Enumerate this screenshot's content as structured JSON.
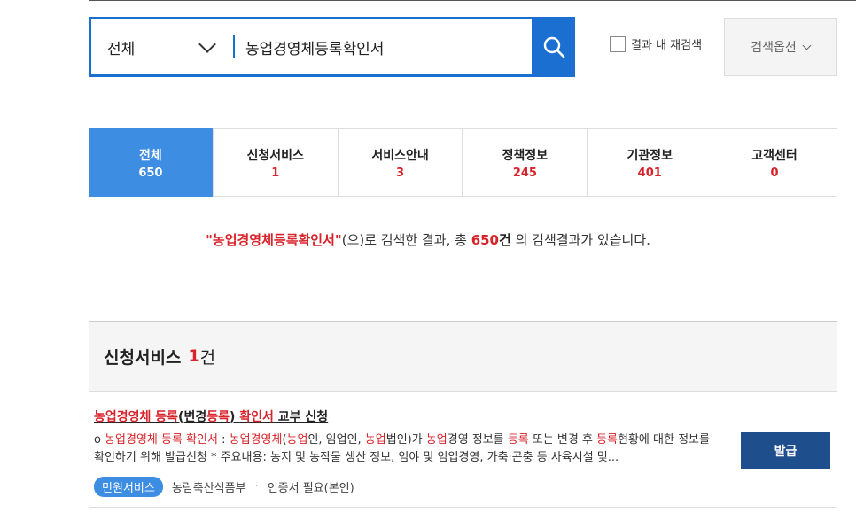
{
  "search": {
    "scope": "전체",
    "query": "농업경영체등록확인서",
    "recheck_label": "결과 내 재검색",
    "options_label": "검색옵션"
  },
  "tabs": [
    {
      "label": "전체",
      "count": "650"
    },
    {
      "label": "신청서비스",
      "count": "1"
    },
    {
      "label": "서비스안내",
      "count": "3"
    },
    {
      "label": "정책정보",
      "count": "245"
    },
    {
      "label": "기관정보",
      "count": "401"
    },
    {
      "label": "고객센터",
      "count": "0"
    }
  ],
  "summary": {
    "keyword": "\"농업경영체등록확인서\"",
    "mid": "(으)로 검색한 결과, 총 ",
    "total": "650",
    "unit": "건",
    "tail": " 의 검색결과가 있습니다."
  },
  "section": {
    "title": "신청서비스",
    "count": "1",
    "unit": "건"
  },
  "result": {
    "title_parts": [
      "농업경영체 등록",
      "(변경",
      "등록",
      ") ",
      "확인서",
      " 교부 신청"
    ],
    "desc_parts": [
      "o ",
      "농업경영체 등록 확인서",
      " : ",
      "농업경영체",
      "(",
      "농업",
      "인, 임업인, ",
      "농업",
      "법인)가 ",
      "농업",
      "경영 정보를 ",
      "등록",
      " 또는 변경 후 ",
      "등록",
      "현황에 대한 정보를 확인하기 위해 발급신청 * 주요내용: 농지 및 농작물 생산 정보, 임야 및 임업경영, 가축·곤충 등 사육시설 및..."
    ],
    "badge": "민원서비스",
    "agency": "농림축산식품부",
    "auth": "인증서 필요(본인)",
    "button": "발급"
  },
  "colors": {
    "accent": "#1a6fd1",
    "highlight": "#d8232a",
    "tab_active": "#3d8de3",
    "button": "#1e4e8c"
  }
}
